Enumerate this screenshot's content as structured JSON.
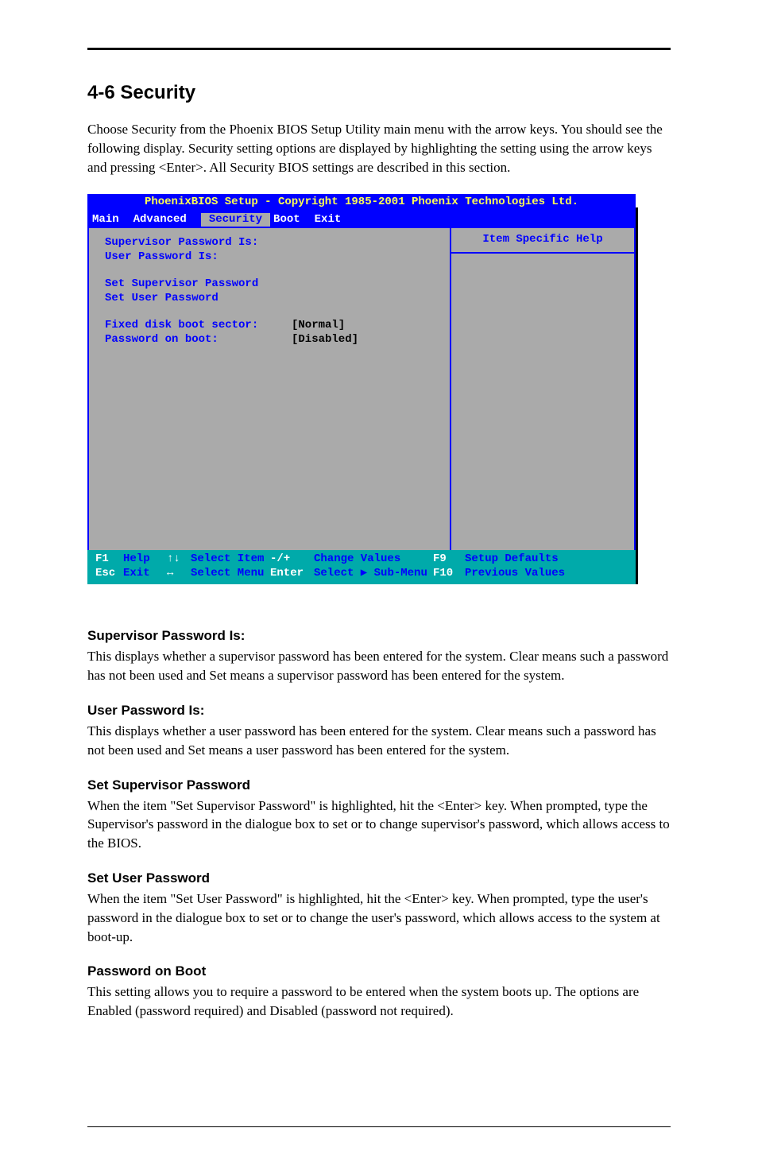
{
  "doc": {
    "heading": "4-6  Security",
    "intro": "Choose Security from the Phoenix BIOS Setup Utility main menu with the arrow keys. You should see the following display. Security setting options are displayed by highlighting the setting using the arrow keys and pressing <Enter>. All Security BIOS settings are described in this section.",
    "fields": [
      {
        "title": "Supervisor Password Is:",
        "desc": "This displays whether a supervisor password has been entered for the system. Clear means such a password has not been used and Set means a supervisor password has been entered for the system."
      },
      {
        "title": "User Password Is:",
        "desc": "This displays whether a user password has been entered for the system. Clear means such a password has not been used and Set means a user password has been entered for the system."
      },
      {
        "title": "Set Supervisor Password",
        "desc": "When the item \"Set Supervisor Password\" is highlighted, hit the <Enter> key. When prompted, type the Supervisor's password in the dialogue box to set or to change supervisor's password, which allows access to the BIOS."
      },
      {
        "title": "Set User Password",
        "desc": "When the item \"Set User Password\" is highlighted, hit the <Enter> key. When prompted, type the user's password in the dialogue box to set or to change the user's password, which allows access to the system at boot-up."
      },
      {
        "title": "Password on Boot",
        "desc": "This setting allows you to require a password to be entered when the system boots up. The options are Enabled (password required) and Disabled (password not required)."
      }
    ]
  },
  "bios": {
    "title": "PhoenixBIOS Setup - Copyright 1985-2001 Phoenix Technologies Ltd.",
    "tabs": [
      "Main",
      "Advanced",
      "Security",
      "Boot",
      "Exit"
    ],
    "selected_tab_index": 2,
    "help_title": "Item Specific Help",
    "items": [
      {
        "label": "Supervisor Password Is:",
        "value": ""
      },
      {
        "label": "User Password Is:",
        "value": ""
      },
      {
        "label": "Set Supervisor Password",
        "value": ""
      },
      {
        "label": "Set User Password",
        "value": ""
      },
      {
        "label": "Fixed disk boot sector:",
        "value": "[Normal]"
      },
      {
        "label": "Password on boot:",
        "value": "[Disabled]"
      }
    ],
    "footer": {
      "r1": [
        "F1",
        "Help",
        "↑↓",
        "Select Item",
        "-/+",
        "Change Values",
        "F9",
        "Setup Defaults"
      ],
      "r2": [
        "Esc",
        "Exit",
        "↔",
        "Select Menu",
        "Enter",
        "Select ▶ Sub-Menu",
        "F10",
        "Previous Values"
      ]
    }
  }
}
